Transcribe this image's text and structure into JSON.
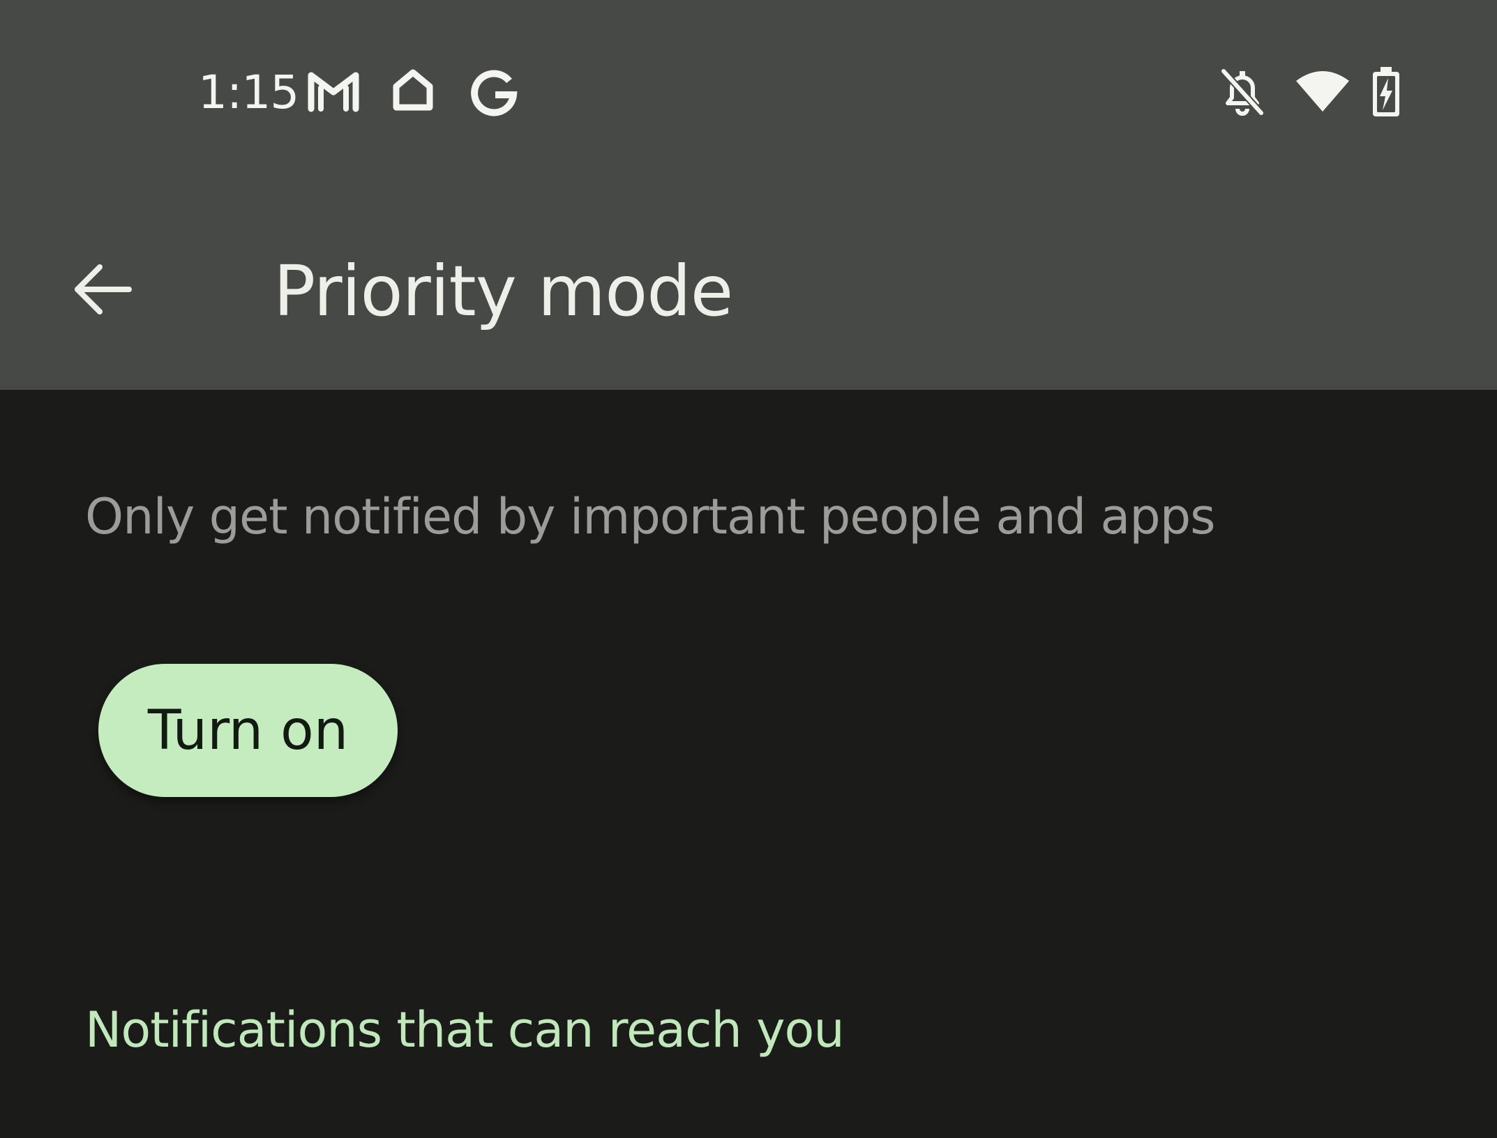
{
  "status_bar": {
    "time": "1:15",
    "left_icons": [
      "gmail-icon",
      "home-icon",
      "google-icon"
    ],
    "right_icons": [
      "notifications-off-icon",
      "wifi-icon",
      "battery-charging-icon"
    ]
  },
  "app_bar": {
    "title": "Priority mode",
    "back_icon": "arrow-back-icon"
  },
  "content": {
    "description": "Only get notified by important people and apps",
    "turn_on_label": "Turn on",
    "section_heading": "Notifications that can reach you"
  },
  "colors": {
    "header_bg": "#474946",
    "page_bg": "#1b1c1a",
    "accent": "#c4ecbf",
    "section_heading": "#c0e8bb",
    "description_text": "#9b9d98"
  }
}
